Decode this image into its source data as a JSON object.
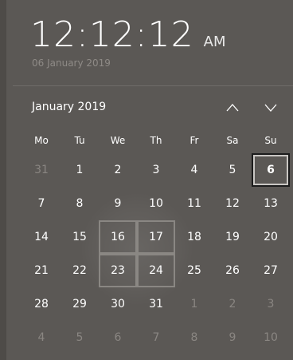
{
  "clock": {
    "time": "12:12:12",
    "ampm": "AM",
    "date_long": "06 January 2019"
  },
  "calendar": {
    "month_label": "January 2019",
    "nav": {
      "prev_icon": "chevron-up-icon",
      "next_icon": "chevron-down-icon"
    },
    "days_of_week": [
      "Mo",
      "Tu",
      "We",
      "Th",
      "Fr",
      "Sa",
      "Su"
    ],
    "weeks": [
      [
        {
          "d": "31",
          "other": true
        },
        {
          "d": "1"
        },
        {
          "d": "2"
        },
        {
          "d": "3"
        },
        {
          "d": "4"
        },
        {
          "d": "5"
        },
        {
          "d": "6",
          "today": true
        }
      ],
      [
        {
          "d": "7"
        },
        {
          "d": "8"
        },
        {
          "d": "9"
        },
        {
          "d": "10"
        },
        {
          "d": "11"
        },
        {
          "d": "12"
        },
        {
          "d": "13"
        }
      ],
      [
        {
          "d": "14"
        },
        {
          "d": "15"
        },
        {
          "d": "16",
          "hover": true
        },
        {
          "d": "17",
          "hover": true
        },
        {
          "d": "18"
        },
        {
          "d": "19"
        },
        {
          "d": "20"
        }
      ],
      [
        {
          "d": "21"
        },
        {
          "d": "22"
        },
        {
          "d": "23",
          "hover": true
        },
        {
          "d": "24",
          "hover": true
        },
        {
          "d": "25"
        },
        {
          "d": "26"
        },
        {
          "d": "27"
        }
      ],
      [
        {
          "d": "28"
        },
        {
          "d": "29"
        },
        {
          "d": "30"
        },
        {
          "d": "31"
        },
        {
          "d": "1",
          "other": true
        },
        {
          "d": "2",
          "other": true
        },
        {
          "d": "3",
          "other": true
        }
      ],
      [
        {
          "d": "4",
          "other": true
        },
        {
          "d": "5",
          "other": true
        },
        {
          "d": "6",
          "other": true
        },
        {
          "d": "7",
          "other": true
        },
        {
          "d": "8",
          "other": true
        },
        {
          "d": "9",
          "other": true
        },
        {
          "d": "10",
          "other": true
        }
      ]
    ]
  },
  "colors": {
    "background": "#5b5855",
    "text": "#ffffff",
    "muted": "#8a8682",
    "today_border": "#1c1c1c"
  }
}
